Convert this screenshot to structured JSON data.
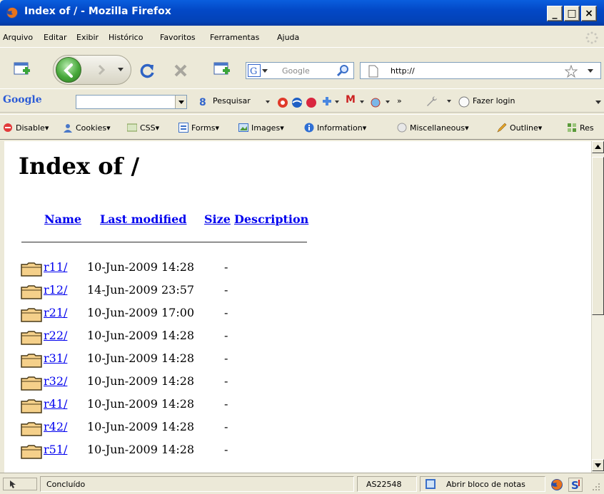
{
  "window": {
    "title": "Index of / - Mozilla Firefox"
  },
  "menu": {
    "items": [
      "Arquivo",
      "Editar",
      "Exibir",
      "Histórico",
      "Favoritos",
      "Ferramentas",
      "Ajuda"
    ]
  },
  "navbar": {
    "search_placeholder": "Google",
    "url": "http://"
  },
  "google_toolbar": {
    "brand": "Google",
    "search_label": "Pesquisar",
    "login_label": "Fazer login",
    "more": "»"
  },
  "webdev_toolbar": {
    "items": [
      "Disable",
      "Cookies",
      "CSS",
      "Forms",
      "Images",
      "Information",
      "Miscellaneous",
      "Outline",
      "Res"
    ]
  },
  "page": {
    "heading": "Index of /",
    "columns": [
      "Name",
      "Last modified",
      "Size",
      "Description"
    ],
    "rows": [
      {
        "name": "r11/",
        "modified": "10-Jun-2009 14:28",
        "size": "-"
      },
      {
        "name": "r12/",
        "modified": "14-Jun-2009 23:57",
        "size": "-"
      },
      {
        "name": "r21/",
        "modified": "10-Jun-2009 17:00",
        "size": "-"
      },
      {
        "name": "r22/",
        "modified": "10-Jun-2009 14:28",
        "size": "-"
      },
      {
        "name": "r31/",
        "modified": "10-Jun-2009 14:28",
        "size": "-"
      },
      {
        "name": "r32/",
        "modified": "10-Jun-2009 14:28",
        "size": "-"
      },
      {
        "name": "r41/",
        "modified": "10-Jun-2009 14:28",
        "size": "-"
      },
      {
        "name": "r42/",
        "modified": "10-Jun-2009 14:28",
        "size": "-"
      },
      {
        "name": "r51/",
        "modified": "10-Jun-2009 14:28",
        "size": "-"
      }
    ]
  },
  "statusbar": {
    "status": "Concluído",
    "asn": "AS22548",
    "notepad": "Abrir bloco de notas"
  },
  "colors": {
    "titlebar": "#0348c6",
    "link": "#0000ee",
    "chrome": "#ece9d8"
  }
}
